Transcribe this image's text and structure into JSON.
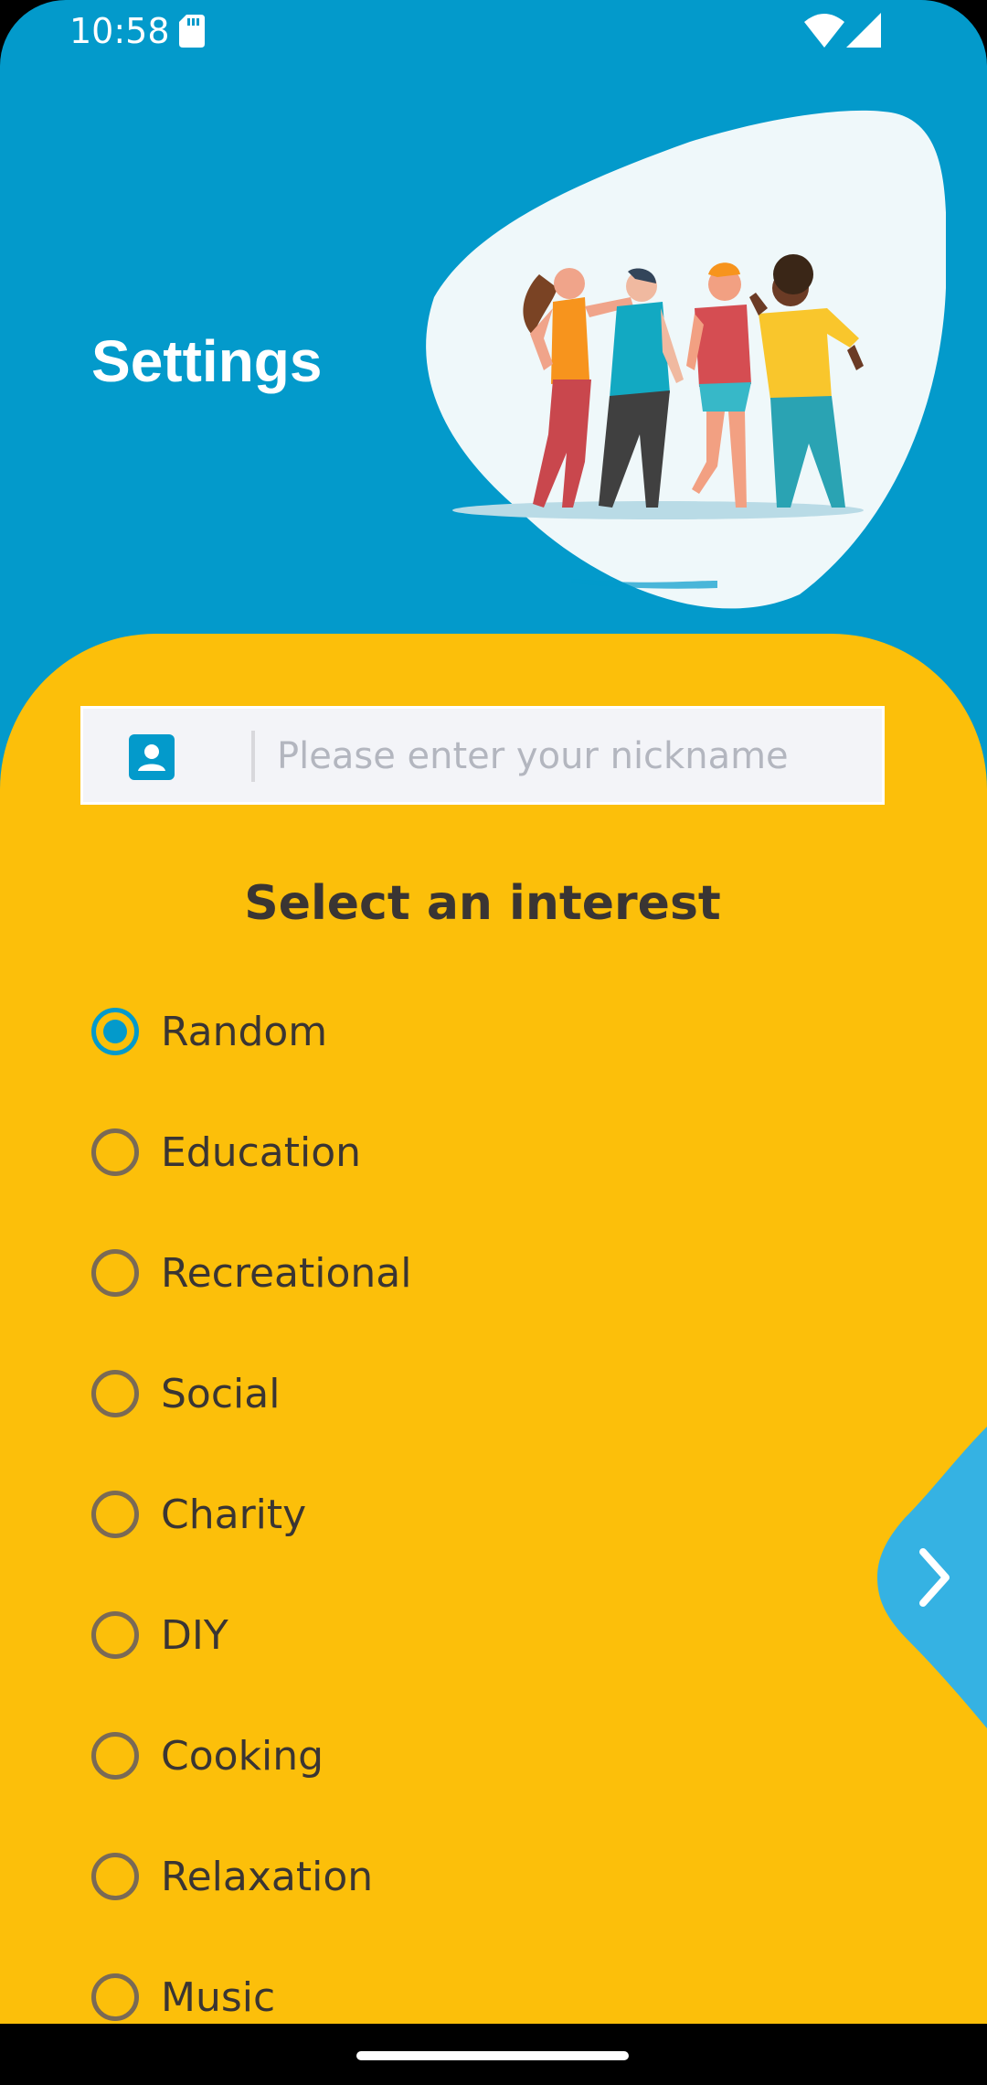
{
  "status_bar": {
    "time": "10:58",
    "icons": [
      "sd-card-icon",
      "wifi-icon",
      "signal-icon"
    ]
  },
  "header": {
    "title": "Settings",
    "illustration": "people-dancing-illustration"
  },
  "nickname": {
    "value": "",
    "placeholder": "Please enter your nickname",
    "icon": "contact-card-icon"
  },
  "interests": {
    "title": "Select an interest",
    "selected": "Random",
    "options": [
      {
        "label": "Random"
      },
      {
        "label": "Education"
      },
      {
        "label": "Recreational"
      },
      {
        "label": "Social"
      },
      {
        "label": "Charity"
      },
      {
        "label": "DIY"
      },
      {
        "label": "Cooking"
      },
      {
        "label": "Relaxation"
      },
      {
        "label": "Music"
      }
    ]
  },
  "next": {
    "icon": "chevron-right-icon"
  },
  "colors": {
    "header_blue": "#039ACB",
    "card_yellow": "#FCBF0A",
    "next_tab_blue": "#35B2E3",
    "radio_selected": "#039ACB"
  }
}
